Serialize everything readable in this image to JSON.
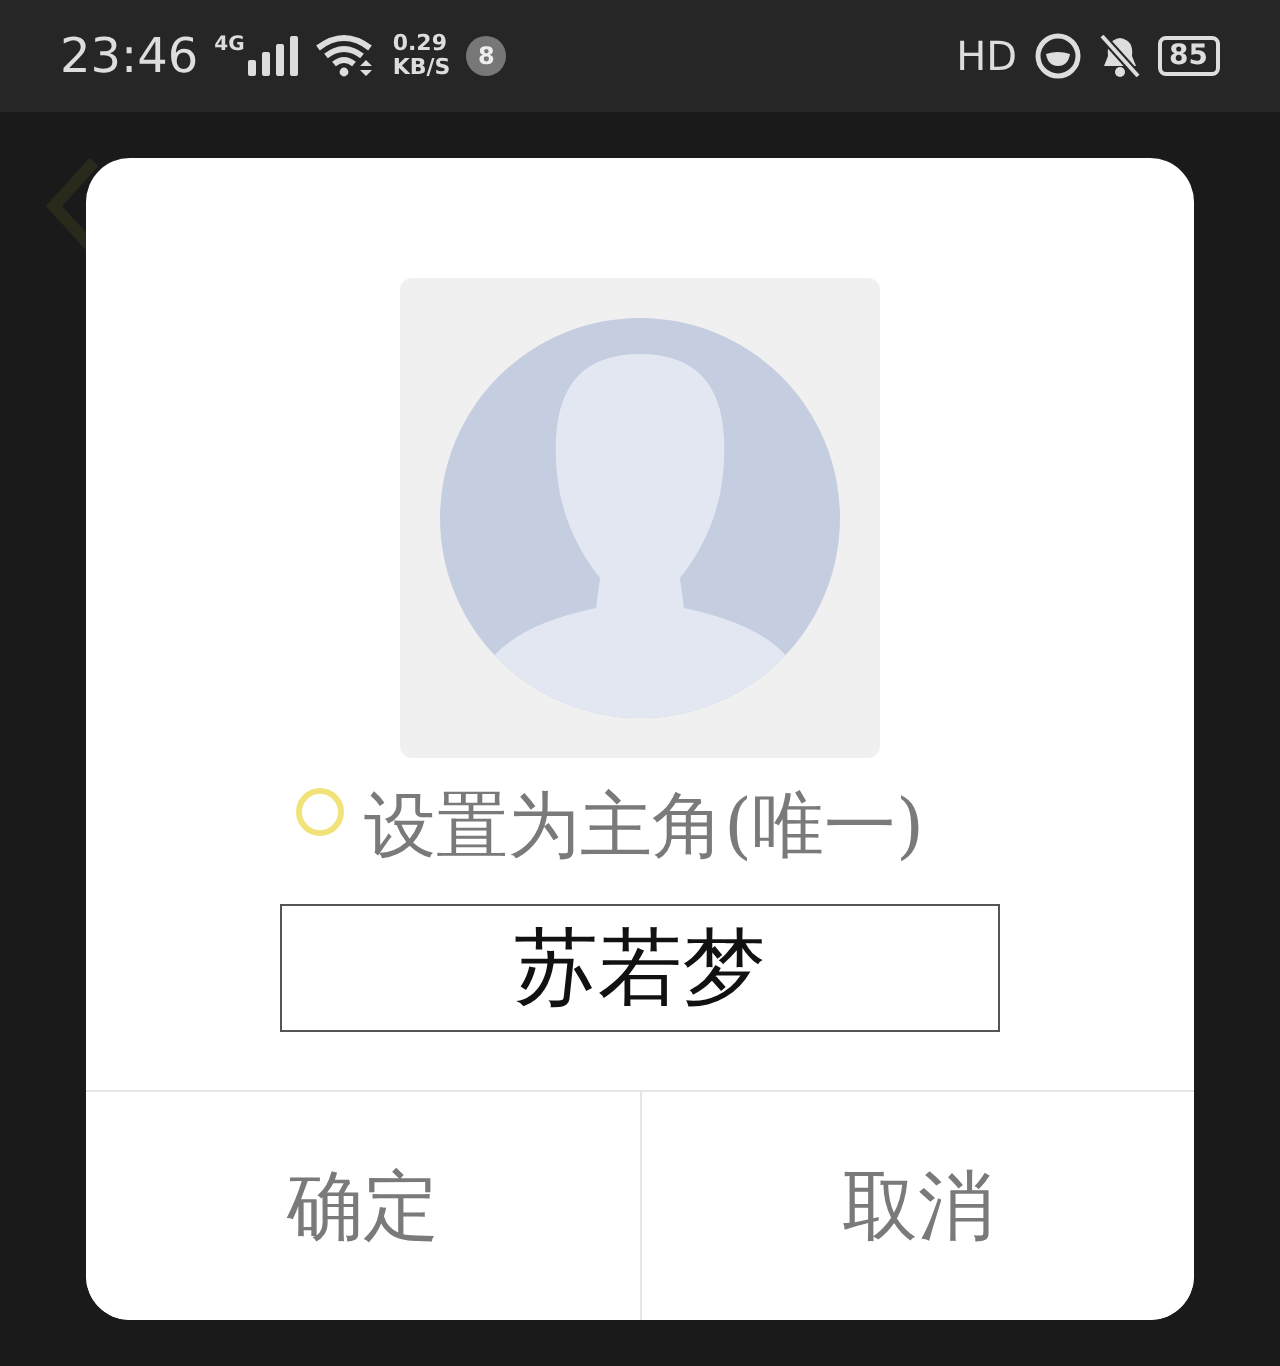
{
  "status_bar": {
    "time": "23:46",
    "network": "4G",
    "speed": "0.29",
    "speed_unit": "KB/S",
    "notification_count": "8",
    "hd": "HD",
    "battery": "85"
  },
  "dialog": {
    "main_role": {
      "label": "设置为主角(唯一)",
      "checked": false
    },
    "name_input": {
      "value": "苏若梦"
    },
    "buttons": [
      {
        "label": "确定"
      },
      {
        "label": "取消"
      }
    ]
  }
}
